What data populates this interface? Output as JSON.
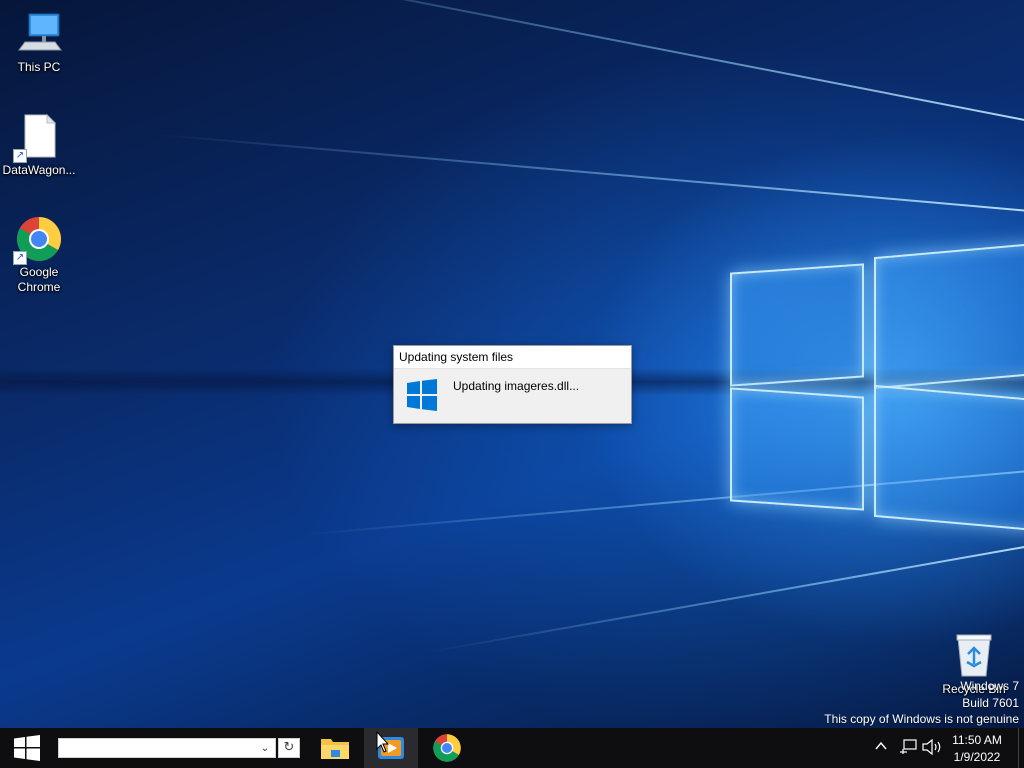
{
  "desktop": {
    "icons": [
      {
        "label": "This PC"
      },
      {
        "label": "DataWagon..."
      },
      {
        "label": "Google Chrome",
        "line1": "Google",
        "line2": "Chrome"
      },
      {
        "label": "Recycle Bin"
      }
    ]
  },
  "dialog": {
    "title": "Updating system files",
    "message": "Updating imageres.dll..."
  },
  "watermark": {
    "line1": "Windows 7",
    "line2": "Build 7601",
    "line3": "This copy of Windows is not genuine"
  },
  "taskbar": {
    "search_value": "",
    "pinned": [
      {
        "name": "File Explorer",
        "icon": "folder-icon"
      },
      {
        "name": "Media app",
        "icon": "media-player-icon",
        "active": true
      },
      {
        "name": "Google Chrome",
        "icon": "chrome-icon"
      }
    ],
    "clock": {
      "time": "11:50 AM",
      "date": "1/9/2022"
    }
  },
  "colors": {
    "taskbar_bg": "#0e0e10",
    "windows_blue": "#0078d7",
    "desktop_accent": "#1a6fe0"
  }
}
